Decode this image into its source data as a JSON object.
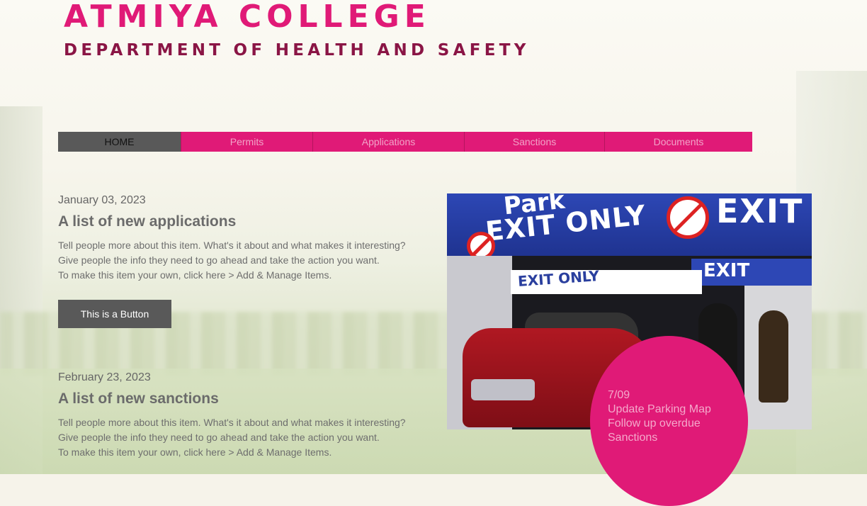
{
  "header": {
    "title": "ATMIYA COLLEGE",
    "subtitle": "DEPARTMENT OF HEALTH AND SAFETY"
  },
  "nav": {
    "items": [
      {
        "label": "HOME",
        "active": true
      },
      {
        "label": "Permits",
        "active": false
      },
      {
        "label": "Applications",
        "active": false
      },
      {
        "label": "Sanctions",
        "active": false
      },
      {
        "label": "Documents",
        "active": false
      }
    ]
  },
  "posts": [
    {
      "date": "January 03, 2023",
      "title": "A list of new applications",
      "description": [
        "Tell people more about this item. What's it about and what makes it interesting?",
        "Give people the info they need to go ahead and take the action you want.",
        "To make this item your own, click here > Add & Manage Items."
      ]
    },
    {
      "date": "February 23, 2023",
      "title": "A list of new sanctions",
      "description": [
        "Tell people more about this item. What's it about and what makes it interesting?",
        "Give people the info they need to go ahead and take the action you want.",
        "To make this item your own, click here > Add & Manage Items."
      ]
    }
  ],
  "button": {
    "label": "This is a Button"
  },
  "photo": {
    "signs": [
      "Park",
      "EXIT ONLY",
      "EXIT",
      "EXIT ONLY",
      "EXIT"
    ]
  },
  "notice": {
    "lines": [
      "7/09",
      "Update Parking Map",
      "Follow up overdue",
      "Sanctions"
    ]
  },
  "colors": {
    "accent": "#e01a77",
    "subtitle": "#8a1545",
    "nav_active": "#595959"
  }
}
